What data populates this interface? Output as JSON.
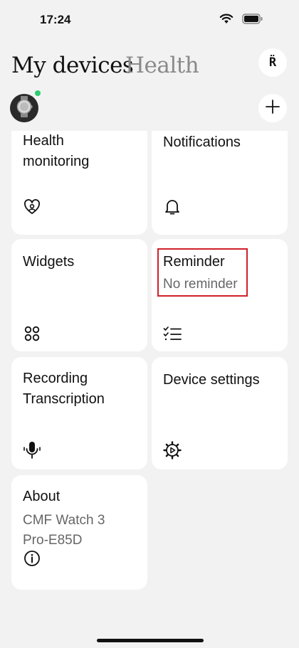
{
  "status_bar": {
    "time": "17:24",
    "icons": [
      "wifi-icon",
      "battery-icon"
    ]
  },
  "header": {
    "tabs": [
      {
        "label": "My devices",
        "active": true
      },
      {
        "label": "Health",
        "active": false
      }
    ],
    "profile_button_label": "R̈"
  },
  "device": {
    "avatar_icon": "watch-icon",
    "status_color": "#2ecc71"
  },
  "add_button_icon": "plus-icon",
  "cards": [
    {
      "title": "Health monitoring",
      "icon": "heart-person-icon"
    },
    {
      "title": "Notifications",
      "icon": "bell-icon"
    },
    {
      "title": "Widgets",
      "icon": "widgets-grid-icon"
    },
    {
      "title": "Reminder",
      "subtitle": "No reminder",
      "icon": "checklist-icon"
    },
    {
      "title": "Recording Transcription",
      "icon": "microphone-icon"
    },
    {
      "title": "Device settings",
      "icon": "settings-gear-icon"
    },
    {
      "title": "About",
      "subtitle": "CMF Watch 3 Pro-E85D",
      "icon": "info-icon"
    }
  ],
  "highlight_color": "#d0202a"
}
